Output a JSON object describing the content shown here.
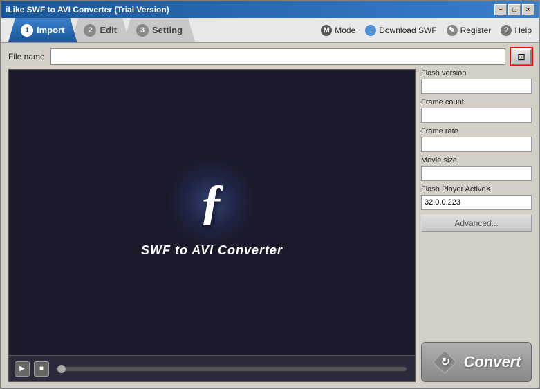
{
  "window": {
    "title": "iLike SWF to AVI Converter (Trial Version)",
    "controls": {
      "minimize": "−",
      "maximize": "□",
      "close": "✕"
    }
  },
  "tabs": [
    {
      "id": "import",
      "num": "1",
      "label": "Import",
      "active": true
    },
    {
      "id": "edit",
      "num": "2",
      "label": "Edit",
      "active": false
    },
    {
      "id": "setting",
      "num": "3",
      "label": "Setting",
      "active": false
    }
  ],
  "toolbar": {
    "mode_label": "Mode",
    "download_label": "Download SWF",
    "register_label": "Register",
    "help_label": "Help"
  },
  "file_row": {
    "label": "File name",
    "placeholder": "",
    "browse_icon": "📁"
  },
  "info_panel": {
    "fields": [
      {
        "id": "flash-version",
        "label": "Flash version",
        "value": ""
      },
      {
        "id": "frame-count",
        "label": "Frame count",
        "value": ""
      },
      {
        "id": "frame-rate",
        "label": "Frame rate",
        "value": ""
      },
      {
        "id": "movie-size",
        "label": "Movie size",
        "value": ""
      },
      {
        "id": "flash-player",
        "label": "Flash Player ActiveX",
        "value": "32.0.0.223"
      }
    ],
    "advanced_btn": "Advanced...",
    "convert_btn": "Convert"
  },
  "preview": {
    "flash_letter": "ƒ",
    "title": "SWF to AVI Converter"
  },
  "player": {
    "play_icon": "▶",
    "stop_icon": "■"
  }
}
